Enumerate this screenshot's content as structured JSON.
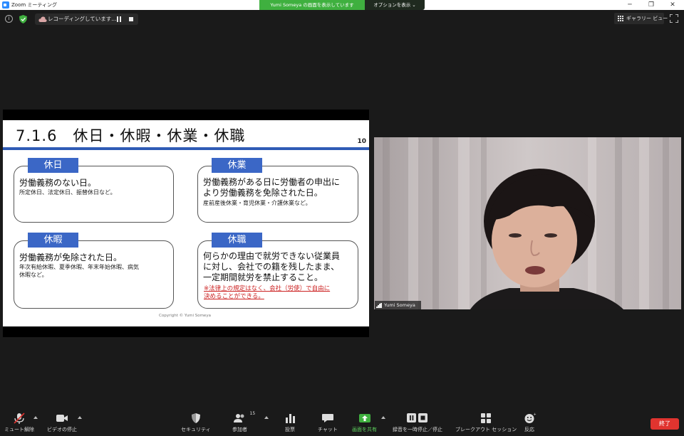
{
  "window": {
    "title": "Zoom ミーティング",
    "controls": [
      "─",
      "❐",
      "✕"
    ]
  },
  "share_banner": {
    "text": "Yumi Someya の画面を表示しています",
    "options_label": "オプションを表示 ⌄"
  },
  "recording": {
    "label": "レコーディングしています..."
  },
  "view": {
    "gallery_label": "ギャラリー ビュー"
  },
  "slide": {
    "title": "7.1.6　休日・休暇・休業・休職",
    "page_number": "10",
    "footer": "Copyright © Yumi Someya",
    "boxes": [
      {
        "tag": "休日",
        "main": [
          "労働義務のない日。"
        ],
        "sub": [
          "所定休日、法定休日、振替休日など。"
        ],
        "note": []
      },
      {
        "tag": "休業",
        "main": [
          "労働義務がある日に労働者の申出に",
          "より労働義務を免除された日。"
        ],
        "sub": [
          "産前産後休業・育児休業・介護休業など。"
        ],
        "note": []
      },
      {
        "tag": "休暇",
        "main": [
          "労働義務が免除された日。"
        ],
        "sub": [
          "年次有給休暇、夏季休暇、年末年始休暇、病気",
          "休暇など。"
        ],
        "note": []
      },
      {
        "tag": "休職",
        "main": [
          "何らかの理由で就労できない従業員",
          "に対し、会社での籍を残したまま、",
          "一定期間就労を禁止すること。"
        ],
        "sub": [],
        "note": [
          "※法律上の規定はなく、会社（労使）で自由に",
          "決めることができる。"
        ]
      }
    ]
  },
  "video": {
    "speaker_name": "Yumi Someya"
  },
  "toolbar": {
    "mute_label": "ミュート解除",
    "video_label": "ビデオの停止",
    "security_label": "セキュリティ",
    "participants_label": "参加者",
    "participants_count": "15",
    "polls_label": "投票",
    "chat_label": "チャット",
    "share_label": "画面を共有",
    "record_label": "録音を一時停止／停止",
    "breakout_label": "ブレークアウト セッション",
    "reactions_label": "反応",
    "end_label": "終了"
  },
  "colors": {
    "share_green": "#3fb03f",
    "slide_blue": "#3b67c6",
    "end_red": "#e0342f",
    "note_red": "#cc2222"
  }
}
